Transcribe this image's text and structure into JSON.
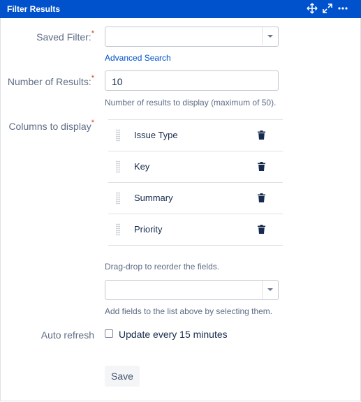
{
  "header": {
    "title": "Filter Results",
    "icons": [
      "move-icon",
      "maximize-icon",
      "more-icon"
    ],
    "bg_color": "#0052cc"
  },
  "form": {
    "saved_filter": {
      "label": "Saved Filter:",
      "required_mark": "*",
      "value": "",
      "advanced_link": "Advanced Search"
    },
    "num_results": {
      "label": "Number of Results:",
      "required_mark": "*",
      "value": "10",
      "help": "Number of results to display (maximum of 50)."
    },
    "columns": {
      "label": "Columns to display",
      "required_mark": "*",
      "items": [
        {
          "label": "Issue Type"
        },
        {
          "label": "Key"
        },
        {
          "label": "Summary"
        },
        {
          "label": "Priority"
        }
      ],
      "reorder_help": "Drag-drop to reorder the fields.",
      "add_select_value": "",
      "add_help": "Add fields to the list above by selecting them."
    },
    "auto_refresh": {
      "label": "Auto refresh",
      "checkbox_label": "Update every 15 minutes",
      "checked": false
    },
    "save_label": "Save"
  }
}
